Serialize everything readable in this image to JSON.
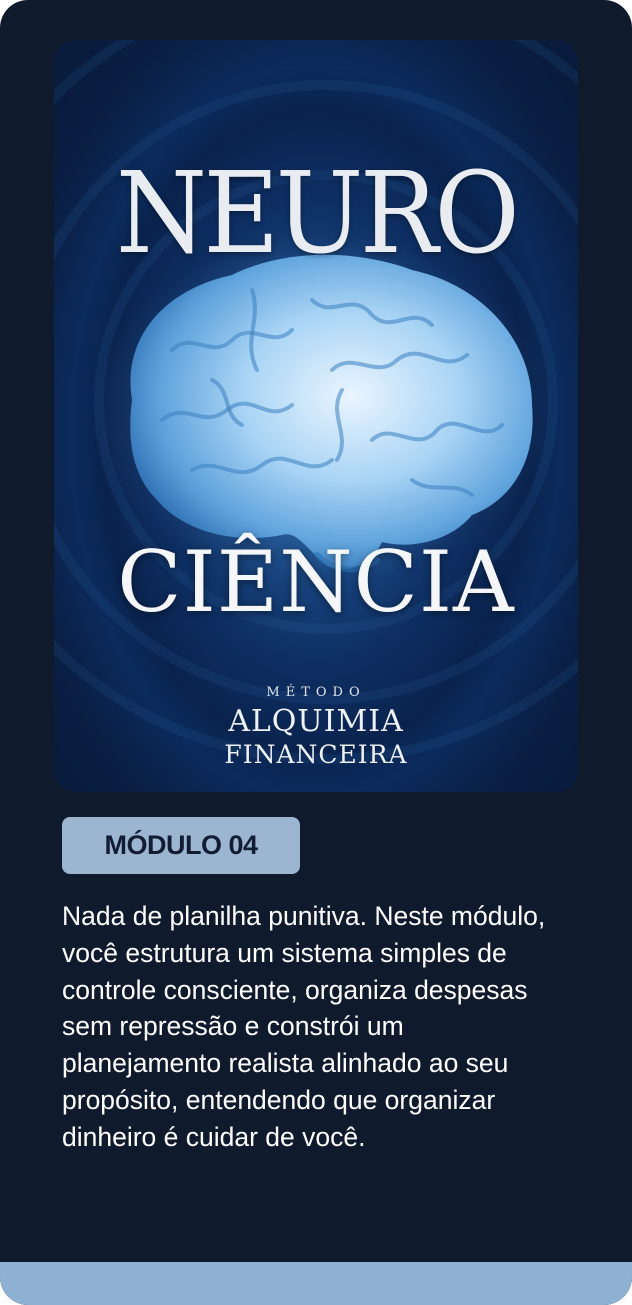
{
  "cover": {
    "title_top": "NEURO",
    "title_bottom": "CIÊNCIA",
    "brand_small": "MÉTODO",
    "brand_mid": "ALQUIMIA",
    "brand_bottom": "FINANCEIRA",
    "image": "brain-illustration"
  },
  "module": {
    "badge_label": "MÓDULO 04",
    "description": "Nada de planilha punitiva. Neste módulo, você estrutura um sistema simples de controle consciente, organiza despesas sem repressão e constrói um planejamento realista alinhado ao seu propósito, entendendo que organizar dinheiro é cuidar de você."
  },
  "colors": {
    "card_background": "#101a2d",
    "badge_background": "#9cb6d2",
    "footer_bar": "#8eb1d1"
  }
}
